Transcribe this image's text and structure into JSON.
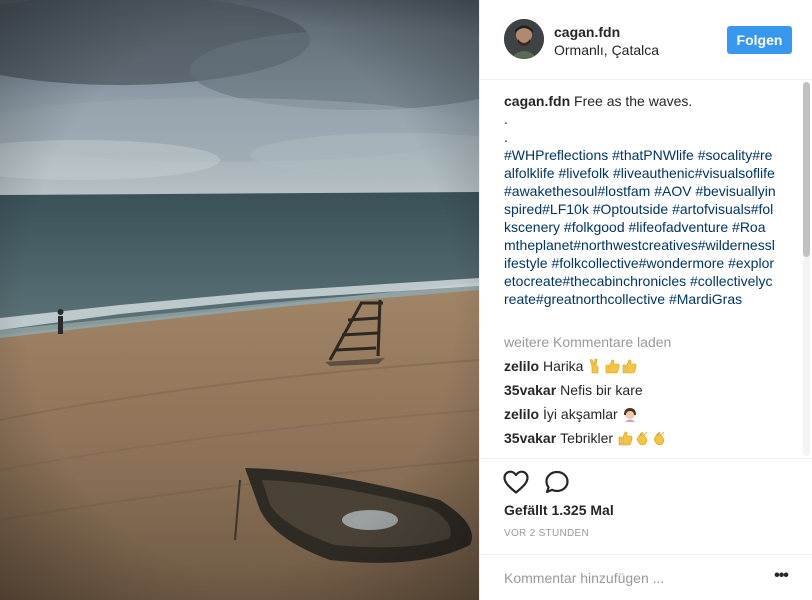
{
  "post": {
    "username": "cagan.fdn",
    "location": "Ormanlı, Çatalca",
    "follow_label": "Folgen"
  },
  "caption": {
    "username": "cagan.fdn",
    "text": "Free as the waves.",
    "dots": [
      ".",
      "."
    ],
    "hashtags": "#WHPreflections #thatPNWlife #socality#realfolklife #livefolk #liveauthenic#visualsoflife #awakethesoul#lostfam #AOV #bevisuallyinspired#LF10k #Optoutside #artofvisuals#folkscenery #folkgood #lifeofadventure #Roamtheplanet#northwestcreatives#wildernesslifestyle #folkcollective#wondermore #exploretocreate#thecabinchronicles #collectivelycreate#greatnorthcollective #MardiGras"
  },
  "load_more_label": "weitere Kommentare laden",
  "comments": [
    {
      "user": "zelilo",
      "text": "Harika",
      "emojis": [
        "victory-hand-emoji",
        "thumbs-up-emoji",
        "thumbs-up-emoji"
      ]
    },
    {
      "user": "35vakar",
      "text": "Nefis bir kare",
      "emojis": []
    },
    {
      "user": "zelilo",
      "text": "İyi akşamlar",
      "emojis": [
        "woman-raising-hand-emoji"
      ]
    },
    {
      "user": "35vakar",
      "text": "Tebrikler",
      "emojis": [
        "thumbs-up-emoji",
        "clapping-hands-emoji",
        "clapping-hands-emoji"
      ]
    }
  ],
  "likes_label": "Gefällt 1.325 Mal",
  "timestamp_label": "VOR 2 STUNDEN",
  "comment_box": {
    "placeholder": "Kommentar hinzufügen ...",
    "more_label": "•••"
  },
  "icons": {
    "heart": "heart-outline-icon",
    "comment": "speech-bubble-icon",
    "more": "more-options-icon"
  },
  "colors": {
    "accent": "#3897f0",
    "hashtag": "#003569",
    "muted": "#999999"
  }
}
